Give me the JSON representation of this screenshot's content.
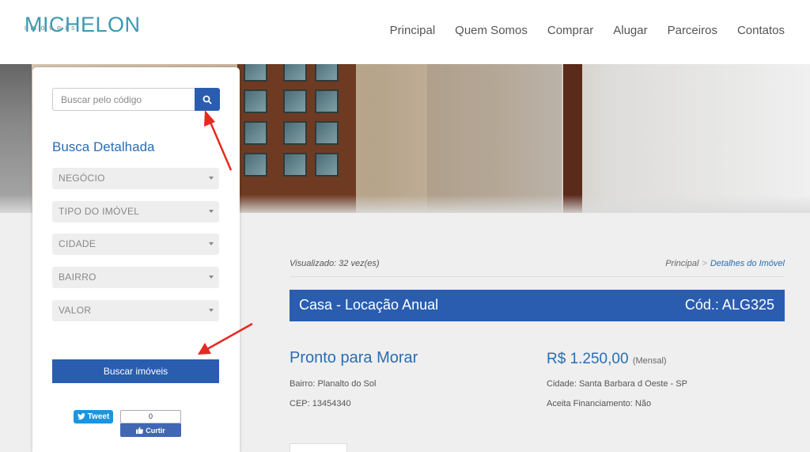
{
  "header": {
    "logo_main": "MICHELON",
    "logo_sub": "imóveis",
    "nav": [
      "Principal",
      "Quem Somos",
      "Comprar",
      "Alugar",
      "Parceiros",
      "Contatos"
    ]
  },
  "sidebar": {
    "search_placeholder": "Buscar pelo código",
    "search_icon": "search-icon",
    "detail_title": "Busca Detalhada",
    "selects": [
      "NEGÓCIO",
      "TIPO DO IMÓVEL",
      "CIDADE",
      "BAIRRO",
      "VALOR"
    ],
    "submit_label": "Buscar imóveis",
    "tweet_label": "Tweet",
    "fb_count": "0",
    "fb_like_label": "Curtir"
  },
  "main": {
    "viewed": "Visualizado: 32 vez(es)",
    "breadcrumb": {
      "home": "Principal",
      "separator": ">",
      "current": "Detalhes do Imóvel"
    },
    "title": "Casa - Locação Anual",
    "code": "Cód.: ALG325",
    "status": "Pronto para Morar",
    "price": "R$ 1.250,00",
    "price_period": "(Mensal)",
    "neighborhood": "Bairro: Planalto do Sol",
    "cep": "CEP: 13454340",
    "city": "Cidade: Santa Barbara d Oeste - SP",
    "financing": "Aceita Financiamento: Não"
  },
  "colors": {
    "brand_blue": "#2a5db0",
    "logo_teal": "#3a9ab3",
    "arrow_red": "#e52a20"
  }
}
